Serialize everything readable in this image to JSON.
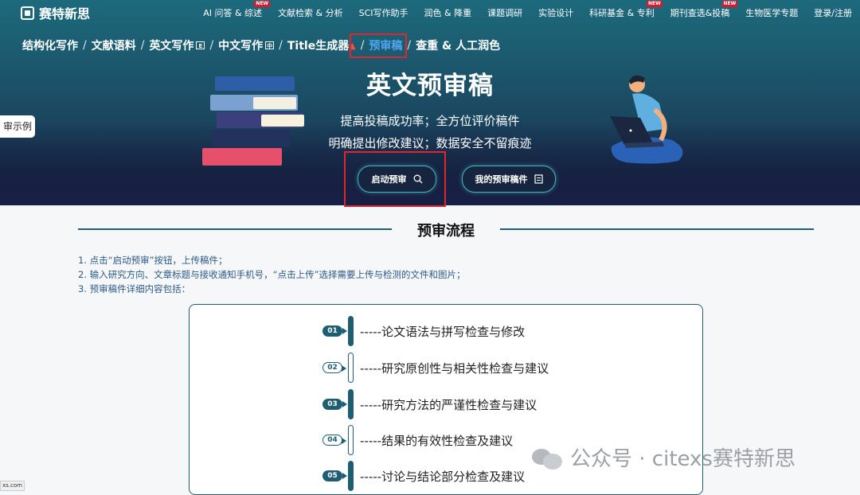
{
  "nav": {
    "brand": "赛特新思",
    "items": [
      {
        "label": "AI 问答 & 综述",
        "badge": "NEW"
      },
      {
        "label": "文献检索 & 分析",
        "badge": ""
      },
      {
        "label": "SCI写作助手",
        "badge": ""
      },
      {
        "label": "润色 & 降重",
        "badge": ""
      },
      {
        "label": "课题调研",
        "badge": ""
      },
      {
        "label": "实验设计",
        "badge": ""
      },
      {
        "label": "科研基金 & 专利",
        "badge": "NEW"
      },
      {
        "label": "期刊查选&投稿",
        "badge": "NEW"
      },
      {
        "label": "生物医学专题",
        "badge": ""
      },
      {
        "label": "登录/注册",
        "badge": ""
      }
    ]
  },
  "breadcrumb": {
    "items": [
      "结构化写作",
      "文献语料",
      "英文写作",
      "中文写作",
      "Title生成器",
      "预审稿",
      "查重 & 人工润色"
    ],
    "separator": "/",
    "active": "预审稿"
  },
  "hero": {
    "title": "英文预审稿",
    "subtitle1": "提高投稿成功率；全方位评价稿件",
    "subtitle2": "明确提出修改建议；数据安全不留痕迹",
    "start_button": "启动预审",
    "my_button": "我的预审稿件",
    "side_tab": "审示例"
  },
  "process": {
    "title": "预审流程",
    "steps": [
      "1. 点击“启动预审”按钮，上传稿件；",
      "2. 输入研究方向、文章标题与接收通知手机号，“点击上传”选择需要上传与检测的文件和图片；",
      "3. 预审稿件详细内容包括："
    ],
    "items": [
      {
        "num": "01",
        "text": "-----论文语法与拼写检查与修改",
        "style": "filled"
      },
      {
        "num": "02",
        "text": "-----研究原创性与相关性检查与建议",
        "style": "outline"
      },
      {
        "num": "03",
        "text": "-----研究方法的严谨性检查与建议",
        "style": "filled"
      },
      {
        "num": "04",
        "text": "-----结果的有效性检查及建议",
        "style": "outline"
      },
      {
        "num": "05",
        "text": "-----讨论与结论部分检查及建议",
        "style": "filled"
      }
    ]
  },
  "watermark": "公众号 · citexs赛特新思",
  "status_url": "xs.com",
  "colors": {
    "accent": "#1f5d72",
    "active_link": "#4ea6f0",
    "highlight": "#e0262d"
  }
}
